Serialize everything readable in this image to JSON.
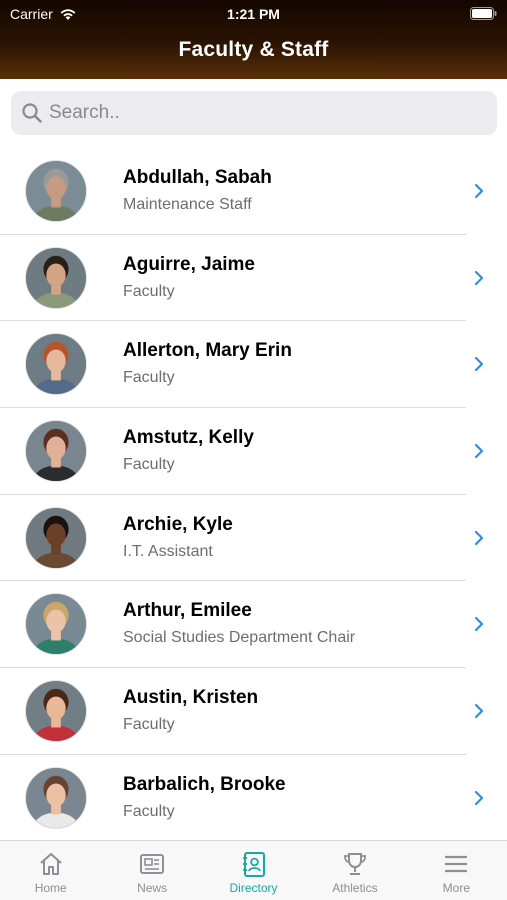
{
  "status_bar": {
    "carrier": "Carrier",
    "time": "1:21 PM"
  },
  "header": {
    "title": "Faculty & Staff"
  },
  "search": {
    "placeholder": "Search.."
  },
  "people": [
    {
      "name": "Abdullah, Sabah",
      "role": "Maintenance Staff",
      "bg": "#7c8c96",
      "skin": "#c79a83",
      "hair": "#9a9a9a",
      "shirt": "#6f7a63"
    },
    {
      "name": "Aguirre, Jaime",
      "role": "Faculty",
      "bg": "#6f7b83",
      "skin": "#d3a385",
      "hair": "#2a1f18",
      "shirt": "#8a9a7c"
    },
    {
      "name": "Allerton, Mary Erin",
      "role": "Faculty",
      "bg": "#6e7c86",
      "skin": "#e6b89c",
      "hair": "#b5562a",
      "shirt": "#556b8c"
    },
    {
      "name": "Amstutz, Kelly",
      "role": "Faculty",
      "bg": "#7a868f",
      "skin": "#e2b097",
      "hair": "#5a2f22",
      "shirt": "#2b2b30"
    },
    {
      "name": "Archie, Kyle",
      "role": "I.T. Assistant",
      "bg": "#707a80",
      "skin": "#6a4128",
      "hair": "#1a120d",
      "shirt": "#6b4a33"
    },
    {
      "name": "Arthur, Emilee",
      "role": "Social Studies Department Chair",
      "bg": "#7a8a94",
      "skin": "#ecc3a6",
      "hair": "#c9a66b",
      "shirt": "#2f7f6d"
    },
    {
      "name": "Austin, Kristen",
      "role": "Faculty",
      "bg": "#727e86",
      "skin": "#e9b898",
      "hair": "#4a2818",
      "shirt": "#c2303a"
    },
    {
      "name": "Barbalich, Brooke",
      "role": "Faculty",
      "bg": "#7b8790",
      "skin": "#ecc0a3",
      "hair": "#6a4330",
      "shirt": "#e9e9ea"
    }
  ],
  "tabs": [
    {
      "label": "Home",
      "icon": "home-icon",
      "active": false
    },
    {
      "label": "News",
      "icon": "news-icon",
      "active": false
    },
    {
      "label": "Directory",
      "icon": "directory-icon",
      "active": true
    },
    {
      "label": "Athletics",
      "icon": "trophy-icon",
      "active": false
    },
    {
      "label": "More",
      "icon": "menu-icon",
      "active": false
    }
  ],
  "colors": {
    "accent": "#1ba7a0",
    "chevron": "#2f8ee5",
    "header_dark": "#140700",
    "header_light": "#5a2f08"
  }
}
